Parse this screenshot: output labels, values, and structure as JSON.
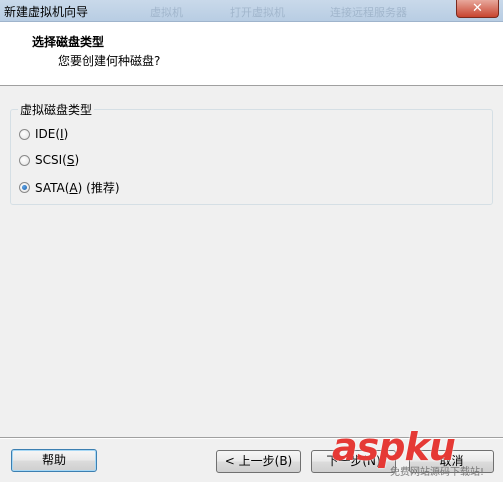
{
  "window": {
    "title": "新建虚拟机向导",
    "ghost_tabs": [
      "虚拟机",
      "打开虚拟机",
      "连接远程服务器"
    ],
    "close_glyph": "✕"
  },
  "header": {
    "title": "选择磁盘类型",
    "subtitle": "您要创建何种磁盘?"
  },
  "disk_group": {
    "label": "虚拟磁盘类型",
    "options": [
      {
        "prefix": "IDE(",
        "key": "I",
        "suffix": ")",
        "checked": false
      },
      {
        "prefix": "SCSI(",
        "key": "S",
        "suffix": ")",
        "checked": false
      },
      {
        "prefix": "SATA(",
        "key": "A",
        "suffix": ")",
        "note": "(推荐)",
        "checked": true
      }
    ]
  },
  "footer": {
    "help": "帮助",
    "back": "< 上一步(B)",
    "next": "下一步(N)",
    "cancel": "取消"
  },
  "watermark": {
    "brand": "aspku",
    "tagline": "免费网站源码下载站!"
  }
}
